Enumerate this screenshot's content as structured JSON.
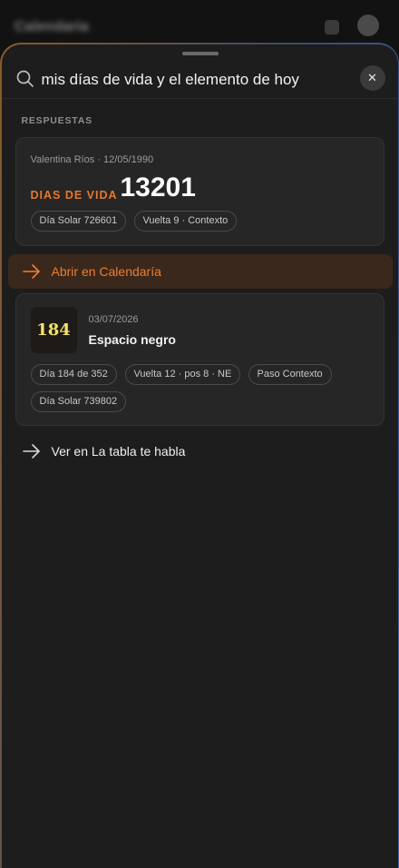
{
  "background": {
    "app_title": "Calendaria"
  },
  "search": {
    "query": "mis días de vida y el elemento de hoy",
    "clear_symbol": "✕"
  },
  "results": {
    "section_label": "RESPUESTAS",
    "life_days": {
      "meta": "Valentina Ríos · 12/05/1990",
      "key": "DIAS DE VIDA",
      "value": "13201",
      "chips": [
        "Día Solar 726601",
        "Vuelta 9 · Contexto"
      ]
    },
    "open_action": {
      "label": "Abrir en Calendaría",
      "icon": "arrow-right-icon",
      "color": "#ef7e2f"
    },
    "element": {
      "number": "184",
      "date": "03/07/2026",
      "name": "Espacio negro",
      "chips": [
        "Día 184 de 352",
        "Vuelta 12 · pos 8 · NE",
        "Paso Contexto",
        "Día Solar 739802"
      ]
    },
    "table_link": {
      "label": "Ver en La tabla te habla",
      "icon": "arrow-right-icon"
    }
  },
  "colors": {
    "accent": "#e9772a",
    "element_number": "#f2e36a"
  }
}
